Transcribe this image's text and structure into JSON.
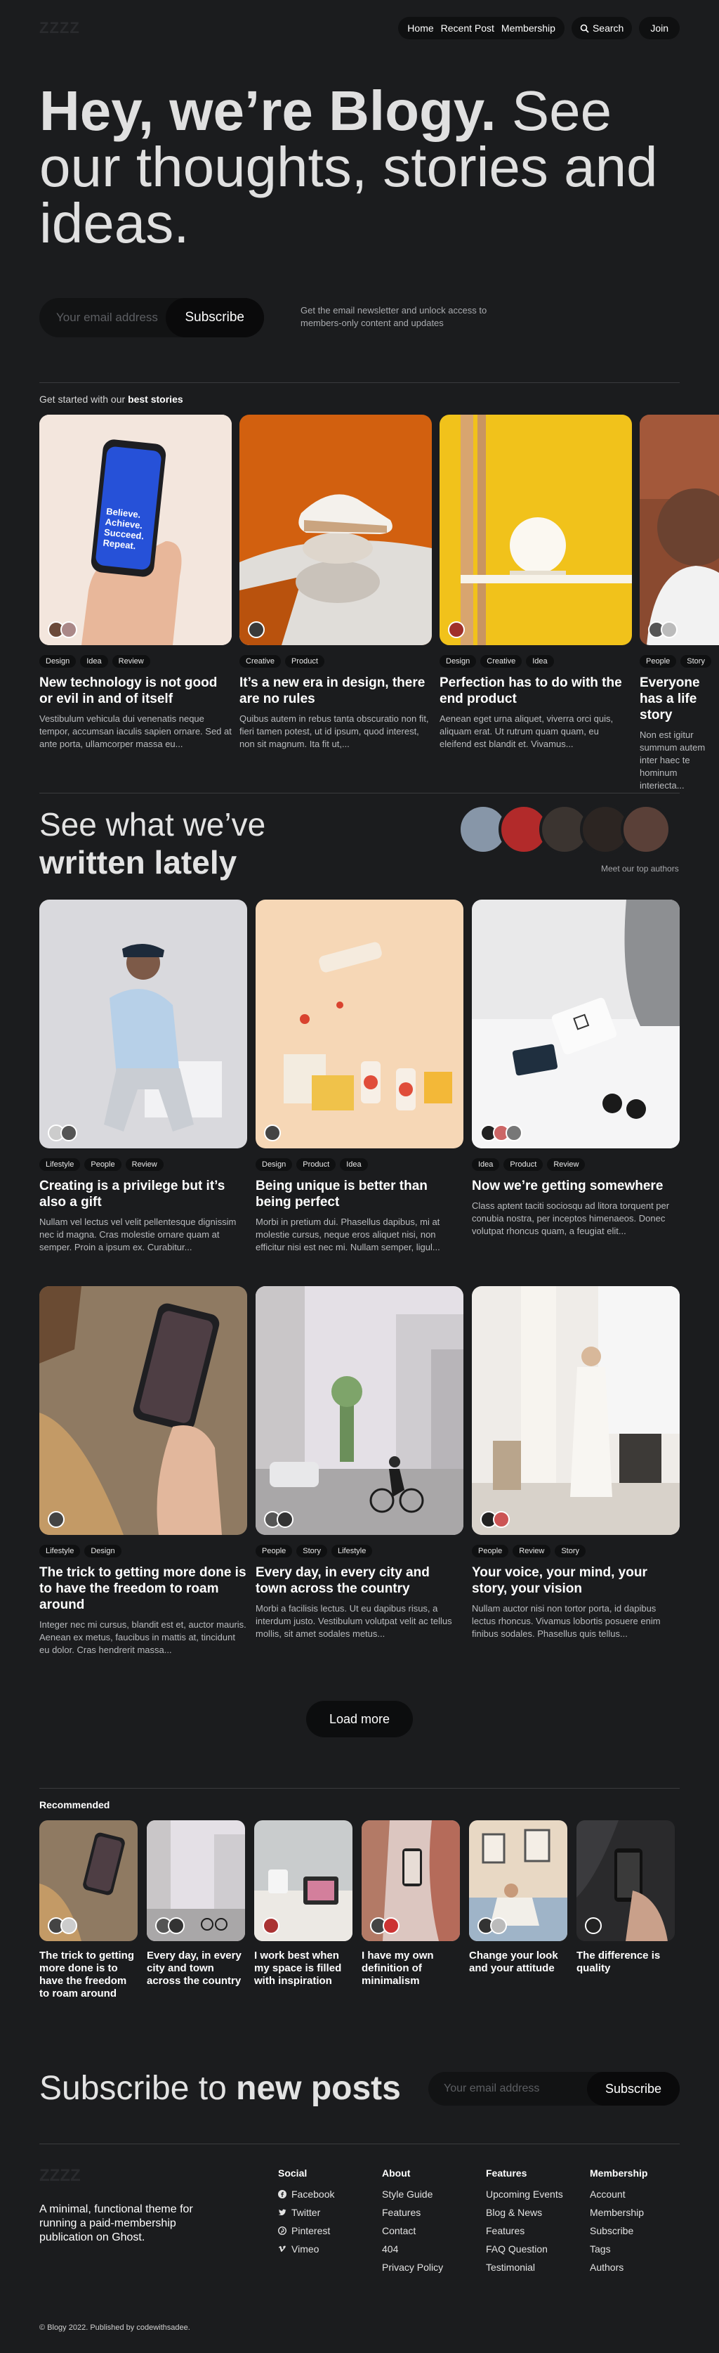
{
  "nav": {
    "logo": "ZZZZ",
    "links": [
      "Home",
      "Recent Post",
      "Membership"
    ],
    "search": "Search",
    "join": "Join"
  },
  "hero": {
    "bold": "Hey, we’re Blogy.",
    "rest": " See our thoughts, stories and ideas."
  },
  "subscribe": {
    "placeholder": "Your email address",
    "button": "Subscribe",
    "note": "Get the email newsletter and unlock access to members-only content and updates"
  },
  "best": {
    "prefix": "Get started with our ",
    "bold": "best stories",
    "cards": [
      {
        "tags": [
          "Design",
          "Idea",
          "Review"
        ],
        "title": "New technology is not good or evil in and of itself",
        "excerpt": "Vestibulum vehicula dui venenatis neque tempor, accumsan iaculis sapien ornare. Sed at ante porta, ullamcorper massa eu...",
        "phone_text": "Believe. Achieve. Succeed. Repeat."
      },
      {
        "tags": [
          "Creative",
          "Product"
        ],
        "title": "It’s a new era in design, there are no rules",
        "excerpt": "Quibus autem in rebus tanta obscuratio non fit, fieri tamen potest, ut id ipsum, quod interest, non sit magnum. Ita fit ut,..."
      },
      {
        "tags": [
          "Design",
          "Creative",
          "Idea"
        ],
        "title": "Perfection has to do with the end product",
        "excerpt": "Aenean eget urna aliquet, viverra orci quis, aliquam erat. Ut rutrum quam quam, eu eleifend est blandit et. Vivamus..."
      },
      {
        "tags": [
          "People",
          "Story"
        ],
        "title": "Everyone has a life story",
        "excerpt": "Non est igitur summum autem inter haec te hominum interiecta..."
      }
    ]
  },
  "latest": {
    "light": "See what we’ve",
    "bold": "written lately",
    "meet": "Meet our top authors",
    "cards": [
      {
        "tags": [
          "Lifestyle",
          "People",
          "Review"
        ],
        "title": "Creating is a privilege but it’s also a gift",
        "excerpt": "Nullam vel lectus vel velit pellentesque dignissim nec id magna. Cras molestie ornare quam at semper. Proin a ipsum ex. Curabitur..."
      },
      {
        "tags": [
          "Design",
          "Product",
          "Idea"
        ],
        "title": "Being unique is better than being perfect",
        "excerpt": "Morbi in pretium dui. Phasellus dapibus, mi at molestie cursus, neque eros aliquet nisi, non efficitur nisi est nec mi. Nullam semper, ligul..."
      },
      {
        "tags": [
          "Idea",
          "Product",
          "Review"
        ],
        "title": "Now we’re getting somewhere",
        "excerpt": "Class aptent taciti sociosqu ad litora torquent per conubia nostra, per inceptos himenaeos. Donec volutpat rhoncus quam, a feugiat elit..."
      },
      {
        "tags": [
          "Lifestyle",
          "Design"
        ],
        "title": "The trick to getting more done is to have the freedom to roam around",
        "excerpt": "Integer nec mi cursus, blandit est et, auctor mauris. Aenean ex metus, faucibus in mattis at, tincidunt eu dolor. Cras hendrerit massa..."
      },
      {
        "tags": [
          "People",
          "Story",
          "Lifestyle"
        ],
        "title": "Every day, in every city and town across the country",
        "excerpt": "Morbi a facilisis lectus. Ut eu dapibus risus, a interdum justo. Vestibulum volutpat velit ac tellus mollis, sit amet sodales metus..."
      },
      {
        "tags": [
          "People",
          "Review",
          "Story"
        ],
        "title": "Your voice, your mind, your story, your vision",
        "excerpt": "Nullam auctor nisi non tortor porta, id dapibus lectus rhoncus. Vivamus lobortis posuere enim finibus sodales. Phasellus quis tellus..."
      }
    ],
    "load_more": "Load more"
  },
  "recommended": {
    "label": "Recommended",
    "cards": [
      {
        "title": "The trick to getting more done is to have the freedom to roam around"
      },
      {
        "title": "Every day, in every city and town across the country"
      },
      {
        "title": "I work best when my space is filled with inspiration"
      },
      {
        "title": "I have my own definition of minimalism"
      },
      {
        "title": "Change your look and your attitude"
      },
      {
        "title": "The difference is quality"
      }
    ]
  },
  "subscribe2": {
    "light": "Subscribe to ",
    "bold": "new posts",
    "placeholder": "Your email address",
    "button": "Subscribe"
  },
  "footer": {
    "logo": "ZZZZ",
    "description": "A minimal, functional theme for running a paid-membership publication on Ghost.",
    "columns": [
      {
        "title": "Social",
        "items": [
          "Facebook",
          "Twitter",
          "Pinterest",
          "Vimeo"
        ]
      },
      {
        "title": "About",
        "items": [
          "Style Guide",
          "Features",
          "Contact",
          "404",
          "Privacy Policy"
        ]
      },
      {
        "title": "Features",
        "items": [
          "Upcoming Events",
          "Blog & News",
          "Features",
          "FAQ Question",
          "Testimonial"
        ]
      },
      {
        "title": "Membership",
        "items": [
          "Account",
          "Membership",
          "Subscribe",
          "Tags",
          "Authors"
        ]
      }
    ],
    "copyright": "© Blogy 2022. Published by codewithsadee."
  },
  "colors": {
    "bg": "#1b1c1e",
    "pill": "#0f1011",
    "accent_yellow": "#f1c21b",
    "accent_orange": "#d9600e"
  }
}
